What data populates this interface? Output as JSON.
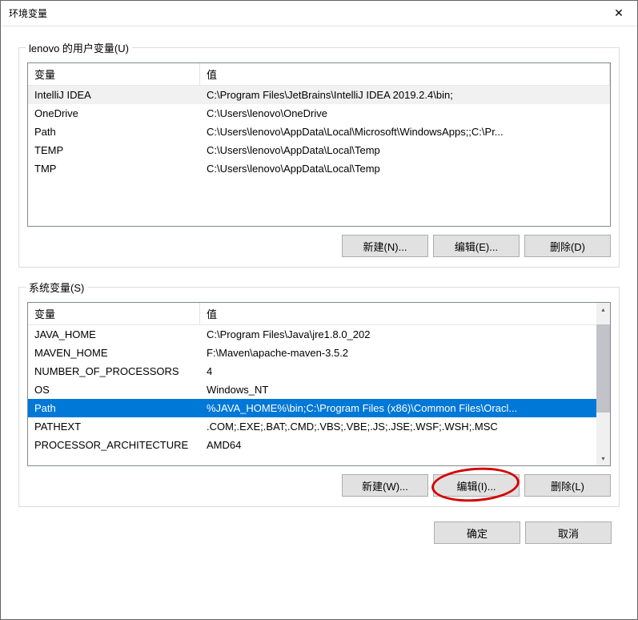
{
  "window": {
    "title": "环境变量"
  },
  "user_section": {
    "label": "lenovo 的用户变量(U)",
    "headers": {
      "var": "变量",
      "val": "值"
    },
    "rows": [
      {
        "var": "IntelliJ IDEA",
        "val": "C:\\Program Files\\JetBrains\\IntelliJ IDEA 2019.2.4\\bin;",
        "highlight": true
      },
      {
        "var": "OneDrive",
        "val": "C:\\Users\\lenovo\\OneDrive"
      },
      {
        "var": "Path",
        "val": "C:\\Users\\lenovo\\AppData\\Local\\Microsoft\\WindowsApps;;C:\\Pr..."
      },
      {
        "var": "TEMP",
        "val": "C:\\Users\\lenovo\\AppData\\Local\\Temp"
      },
      {
        "var": "TMP",
        "val": "C:\\Users\\lenovo\\AppData\\Local\\Temp"
      }
    ],
    "buttons": {
      "new": "新建(N)...",
      "edit": "编辑(E)...",
      "delete": "删除(D)"
    }
  },
  "system_section": {
    "label": "系统变量(S)",
    "headers": {
      "var": "变量",
      "val": "值"
    },
    "rows": [
      {
        "var": "JAVA_HOME",
        "val": "C:\\Program Files\\Java\\jre1.8.0_202"
      },
      {
        "var": "MAVEN_HOME",
        "val": "F:\\Maven\\apache-maven-3.5.2"
      },
      {
        "var": "NUMBER_OF_PROCESSORS",
        "val": "4"
      },
      {
        "var": "OS",
        "val": "Windows_NT"
      },
      {
        "var": "Path",
        "val": "%JAVA_HOME%\\bin;C:\\Program Files (x86)\\Common Files\\Oracl...",
        "selected": true
      },
      {
        "var": "PATHEXT",
        "val": ".COM;.EXE;.BAT;.CMD;.VBS;.VBE;.JS;.JSE;.WSF;.WSH;.MSC"
      },
      {
        "var": "PROCESSOR_ARCHITECTURE",
        "val": "AMD64"
      }
    ],
    "buttons": {
      "new": "新建(W)...",
      "edit": "编辑(I)...",
      "delete": "删除(L)"
    }
  },
  "dialog_buttons": {
    "ok": "确定",
    "cancel": "取消"
  }
}
